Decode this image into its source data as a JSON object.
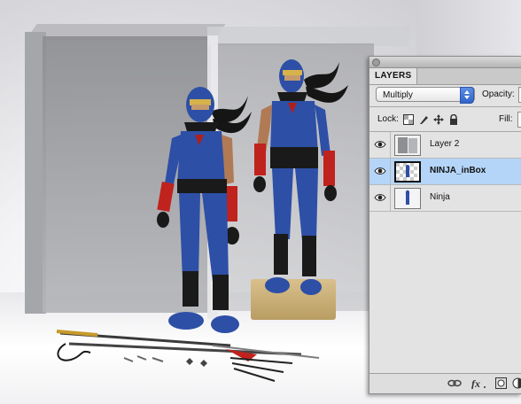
{
  "panel": {
    "tab_label": "LAYERS",
    "blend_mode": "Multiply",
    "opacity_label": "Opacity:",
    "lock_label": "Lock:",
    "fill_label": "Fill:",
    "layers": [
      {
        "name": "Layer 2",
        "visible": true,
        "selected": false
      },
      {
        "name": "NINJA_inBox",
        "visible": true,
        "selected": true
      },
      {
        "name": "Ninja",
        "visible": true,
        "selected": false
      }
    ],
    "icons": {
      "lock_buttons": [
        "lock-transparent-pixels-icon",
        "lock-image-pixels-icon",
        "lock-position-icon",
        "lock-all-icon"
      ],
      "bottom": [
        "link-layers-icon",
        "layer-style-fx-icon",
        "add-mask-icon",
        "new-fill-layer-icon"
      ]
    }
  },
  "colors": {
    "selection": "#b5d5f8",
    "select_accent": "#2f63c9",
    "ninja_suit": "#2d4fa6",
    "ninja_gauntlet": "#c0221d"
  }
}
